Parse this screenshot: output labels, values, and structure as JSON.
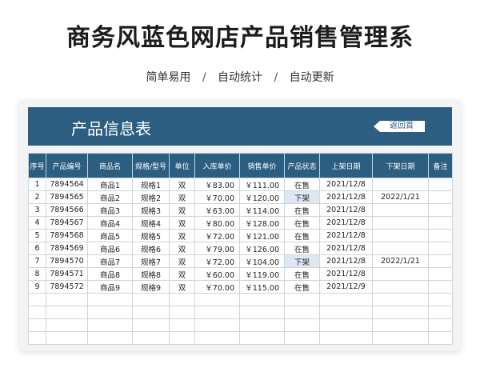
{
  "header": {
    "title": "商务风蓝色网店产品销售管理系",
    "subtitle_parts": [
      "简单易用",
      "自动统计",
      "自动更新"
    ],
    "separator": "/"
  },
  "banner": {
    "title": "产品信息表",
    "back_button_label": "返回首"
  },
  "colors": {
    "brand": "#2b5e80",
    "off_shelf_highlight": "#dfe7f3"
  },
  "table": {
    "columns": [
      "序号",
      "产品编号",
      "商品名",
      "规格/型号",
      "单位",
      "入库单价",
      "销售单价",
      "产品状态",
      "上架日期",
      "下架日期",
      "备注"
    ],
    "rows": [
      [
        "1",
        "7894564",
        "商品1",
        "规格1",
        "双",
        "￥83.00",
        "￥111.00",
        "在售",
        "2021/12/8",
        "",
        ""
      ],
      [
        "2",
        "7894565",
        "商品2",
        "规格2",
        "双",
        "￥70.00",
        "￥120.00",
        "下架",
        "2021/12/8",
        "2022/1/21",
        ""
      ],
      [
        "3",
        "7894566",
        "商品3",
        "规格3",
        "双",
        "￥63.00",
        "￥114.00",
        "在售",
        "2021/12/8",
        "",
        ""
      ],
      [
        "4",
        "7894567",
        "商品4",
        "规格4",
        "双",
        "￥80.00",
        "￥128.00",
        "在售",
        "2021/12/8",
        "",
        ""
      ],
      [
        "5",
        "7894568",
        "商品5",
        "规格5",
        "双",
        "￥72.00",
        "￥121.00",
        "在售",
        "2021/12/8",
        "",
        ""
      ],
      [
        "6",
        "7894569",
        "商品6",
        "规格6",
        "双",
        "￥79.00",
        "￥126.00",
        "在售",
        "2021/12/8",
        "",
        ""
      ],
      [
        "7",
        "7894570",
        "商品7",
        "规格7",
        "双",
        "￥72.00",
        "￥104.00",
        "下架",
        "2021/12/8",
        "2022/1/21",
        ""
      ],
      [
        "8",
        "7894571",
        "商品8",
        "规格8",
        "双",
        "￥60.00",
        "￥119.00",
        "在售",
        "2021/12/8",
        "",
        ""
      ],
      [
        "9",
        "7894572",
        "商品9",
        "规格9",
        "双",
        "￥70.00",
        "￥115.00",
        "在售",
        "2021/12/9",
        "",
        ""
      ],
      [
        "",
        "",
        "",
        "",
        "",
        "",
        "",
        "",
        "",
        "",
        ""
      ],
      [
        "",
        "",
        "",
        "",
        "",
        "",
        "",
        "",
        "",
        "",
        ""
      ],
      [
        "",
        "",
        "",
        "",
        "",
        "",
        "",
        "",
        "",
        "",
        ""
      ],
      [
        "",
        "",
        "",
        "",
        "",
        "",
        "",
        "",
        "",
        "",
        ""
      ]
    ]
  }
}
